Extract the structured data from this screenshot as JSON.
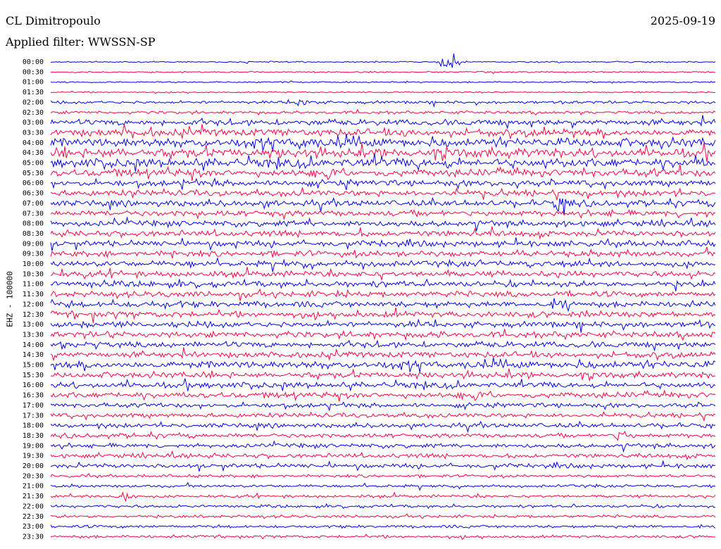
{
  "header": {
    "station": "CL Dimitropoulo",
    "filter": "Applied filter: WWSSN-SP",
    "date": "2025-09-19",
    "channel": "EHZ - 100000"
  },
  "colors": {
    "trace_a": "#0000ee",
    "trace_b": "#ff0040",
    "background": "#ffffff"
  },
  "chart_data": {
    "type": "line",
    "title": "CL Dimitropoulo",
    "subtitle": "Applied filter: WWSSN-SP",
    "ylabel": "EHZ - 100000",
    "x_range_minutes": [
      0,
      15
    ],
    "row_labels": [
      "00:00",
      "00:30",
      "01:00",
      "01:30",
      "02:00",
      "02:30",
      "03:00",
      "03:30",
      "04:00",
      "04:30",
      "05:00",
      "05:30",
      "06:00",
      "06:30",
      "07:00",
      "07:30",
      "08:00",
      "08:30",
      "09:00",
      "09:30",
      "10:00",
      "10:30",
      "11:00",
      "11:30",
      "12:00",
      "12:30",
      "13:00",
      "13:30",
      "14:00",
      "14:30",
      "15:00",
      "15:30",
      "16:00",
      "16:30",
      "17:00",
      "17:30",
      "18:00",
      "18:30",
      "19:00",
      "19:30",
      "20:00",
      "20:30",
      "21:00",
      "21:30",
      "22:00",
      "22:30",
      "23:00",
      "23:30"
    ],
    "row_noise_level": [
      1,
      1,
      1,
      1,
      2,
      2,
      4,
      5,
      6,
      6,
      6,
      5,
      4,
      4,
      4,
      4,
      4,
      4,
      4,
      4,
      4,
      4,
      4,
      4,
      4,
      4,
      4,
      4,
      4,
      4,
      5,
      4,
      4,
      4,
      3,
      3,
      3,
      3,
      3,
      3,
      3,
      2,
      2,
      2,
      2,
      2,
      2,
      2
    ],
    "events": [
      {
        "row": 0,
        "x_fraction": 0.6,
        "amplitude": 6
      },
      {
        "row": 4,
        "x_fraction": 0.38,
        "amplitude": 3
      },
      {
        "row": 8,
        "x_fraction": 0.38,
        "amplitude": 3
      },
      {
        "row": 14,
        "x_fraction": 0.77,
        "amplitude": 4
      },
      {
        "row": 24,
        "x_fraction": 0.77,
        "amplitude": 3
      },
      {
        "row": 37,
        "x_fraction": 0.86,
        "amplitude": 3
      },
      {
        "row": 43,
        "x_fraction": 0.11,
        "amplitude": 4
      }
    ]
  }
}
